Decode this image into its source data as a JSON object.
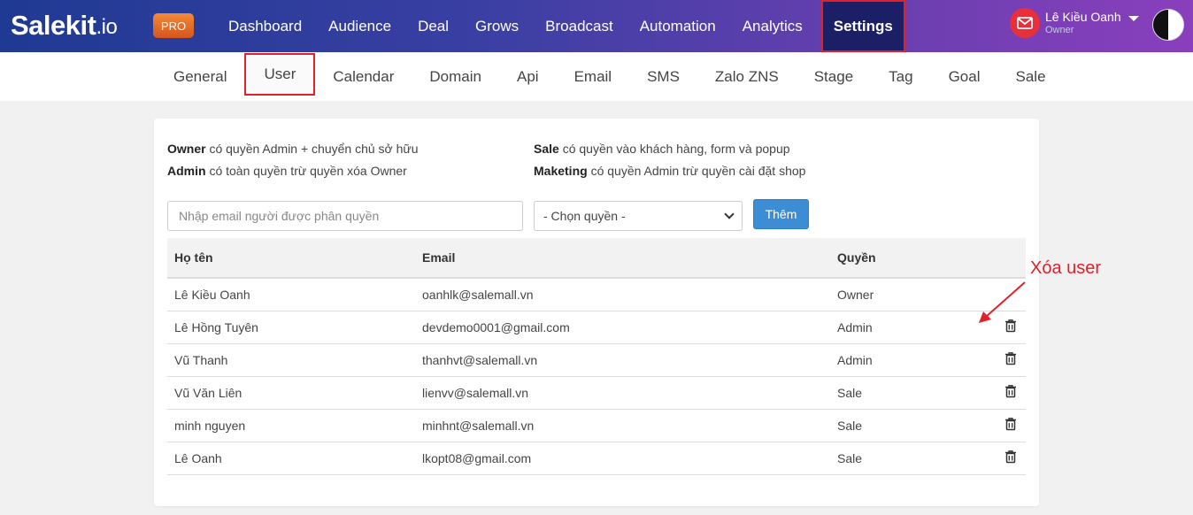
{
  "brand": {
    "name": "Salekit",
    "suffix": ".io",
    "badge": "PRO"
  },
  "mainnav": {
    "items": [
      "Dashboard",
      "Audience",
      "Deal",
      "Grows",
      "Broadcast",
      "Automation",
      "Analytics",
      "Settings"
    ],
    "active": "Settings"
  },
  "user": {
    "name": "Lê Kiều Oanh",
    "role": "Owner"
  },
  "subnav": {
    "items": [
      "General",
      "User",
      "Calendar",
      "Domain",
      "Api",
      "Email",
      "SMS",
      "Zalo ZNS",
      "Stage",
      "Tag",
      "Goal",
      "Sale"
    ],
    "active": "User"
  },
  "notes": {
    "owner_role": "Owner",
    "owner_desc": "có quyền Admin + chuyển chủ sở hữu",
    "admin_role": "Admin",
    "admin_desc": "có toàn quyền trừ quyền xóa Owner",
    "sale_role": "Sale",
    "sale_desc": "có quyền vào khách hàng, form và popup",
    "maketing_role": "Maketing",
    "maketing_desc": "có quyền Admin trừ quyền cài đặt shop"
  },
  "form": {
    "email_placeholder": "Nhập email người được phân quyền",
    "role_select_value": "- Chọn quyền -",
    "add_button": "Thêm"
  },
  "table": {
    "headers": {
      "name": "Họ tên",
      "email": "Email",
      "role": "Quyền"
    },
    "rows": [
      {
        "name": "Lê Kiều Oanh",
        "email": "oanhlk@salemall.vn",
        "role": "Owner",
        "deletable": false
      },
      {
        "name": "Lê Hồng Tuyên",
        "email": "devdemo0001@gmail.com",
        "role": "Admin",
        "deletable": true
      },
      {
        "name": "Vũ Thanh",
        "email": "thanhvt@salemall.vn",
        "role": "Admin",
        "deletable": true
      },
      {
        "name": "Vũ Văn Liên",
        "email": "lienvv@salemall.vn",
        "role": "Sale",
        "deletable": true
      },
      {
        "name": "minh nguyen",
        "email": "minhnt@salemall.vn",
        "role": "Sale",
        "deletable": true
      },
      {
        "name": "Lê Oanh",
        "email": "lkopt08@gmail.com",
        "role": "Sale",
        "deletable": true
      }
    ]
  },
  "annotation": {
    "label": "Xóa user",
    "color": "#e0202a"
  },
  "icons": {
    "mail": "mail-icon",
    "delete": "trash-icon",
    "dropdown": "caret-down-icon"
  }
}
